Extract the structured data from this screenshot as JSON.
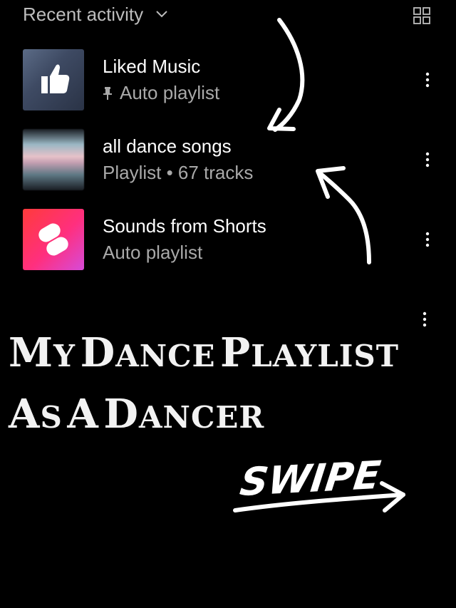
{
  "header": {
    "title": "Recent activity"
  },
  "items": [
    {
      "title": "Liked Music",
      "subtitle": "Auto playlist",
      "pinned": true,
      "thumb_icon": "thumbs-up-icon"
    },
    {
      "title": "all dance songs",
      "subtitle": "Playlist • 67 tracks",
      "pinned": false,
      "thumb_icon": "playlist-cover-image"
    },
    {
      "title": "Sounds from Shorts",
      "subtitle": "Auto playlist",
      "pinned": false,
      "thumb_icon": "shorts-logo-icon"
    }
  ],
  "caption": {
    "line1_caps": [
      "M",
      "Y",
      "D",
      "ANCE",
      "P",
      "LAYLIST"
    ],
    "line1": "My dance playlist",
    "line2": "as a dancer"
  },
  "swipe": "SWIPE",
  "colors": {
    "background": "#000000",
    "secondary_text": "#a9a9a9",
    "shorts_red": "#ff3b3b",
    "shorts_pink": "#ff2f7e"
  }
}
